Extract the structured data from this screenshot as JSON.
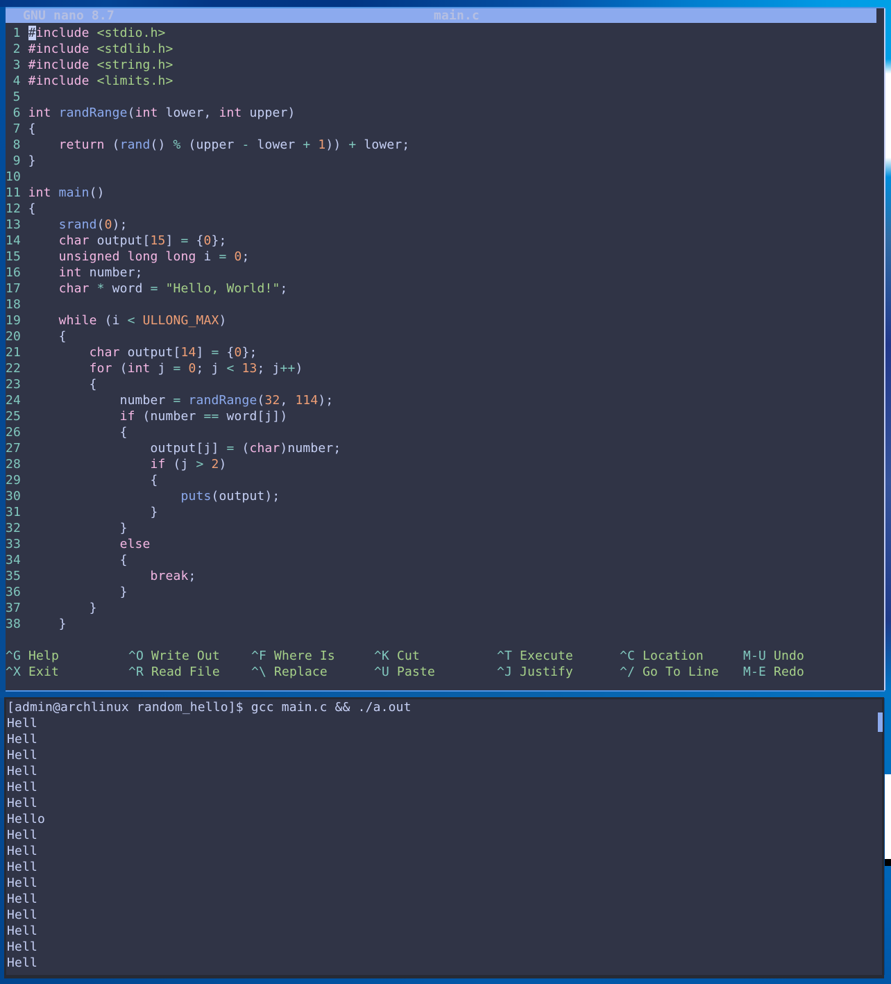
{
  "editor": {
    "app_title": "GNU nano 8.7",
    "filename": "main.c",
    "lines": [
      {
        "num": "1",
        "tok": [
          [
            "cur",
            "#"
          ],
          [
            "k",
            "include"
          ],
          [
            "t",
            " "
          ],
          [
            "s",
            "<stdio.h>"
          ]
        ]
      },
      {
        "num": "2",
        "tok": [
          [
            "k",
            "#include"
          ],
          [
            "t",
            " "
          ],
          [
            "s",
            "<stdlib.h>"
          ]
        ]
      },
      {
        "num": "3",
        "tok": [
          [
            "k",
            "#include"
          ],
          [
            "t",
            " "
          ],
          [
            "s",
            "<string.h>"
          ]
        ]
      },
      {
        "num": "4",
        "tok": [
          [
            "k",
            "#include"
          ],
          [
            "t",
            " "
          ],
          [
            "s",
            "<limits.h>"
          ]
        ]
      },
      {
        "num": "5",
        "tok": []
      },
      {
        "num": "6",
        "tok": [
          [
            "k",
            "int"
          ],
          [
            "t",
            " "
          ],
          [
            "f",
            "randRange"
          ],
          [
            "t",
            "("
          ],
          [
            "k",
            "int"
          ],
          [
            "t",
            " lower, "
          ],
          [
            "k",
            "int"
          ],
          [
            "t",
            " upper)"
          ]
        ]
      },
      {
        "num": "7",
        "tok": [
          [
            "t",
            "{"
          ]
        ]
      },
      {
        "num": "8",
        "tok": [
          [
            "t",
            "    "
          ],
          [
            "k",
            "return"
          ],
          [
            "t",
            " ("
          ],
          [
            "f",
            "rand"
          ],
          [
            "t",
            "() "
          ],
          [
            "o",
            "%"
          ],
          [
            "t",
            " (upper "
          ],
          [
            "o",
            "-"
          ],
          [
            "t",
            " lower "
          ],
          [
            "o",
            "+"
          ],
          [
            "t",
            " "
          ],
          [
            "n",
            "1"
          ],
          [
            "t",
            ")) "
          ],
          [
            "o",
            "+"
          ],
          [
            "t",
            " lower;"
          ]
        ]
      },
      {
        "num": "9",
        "tok": [
          [
            "t",
            "}"
          ]
        ]
      },
      {
        "num": "10",
        "tok": []
      },
      {
        "num": "11",
        "tok": [
          [
            "k",
            "int"
          ],
          [
            "t",
            " "
          ],
          [
            "f",
            "main"
          ],
          [
            "t",
            "()"
          ]
        ]
      },
      {
        "num": "12",
        "tok": [
          [
            "t",
            "{"
          ]
        ]
      },
      {
        "num": "13",
        "tok": [
          [
            "t",
            "    "
          ],
          [
            "f",
            "srand"
          ],
          [
            "t",
            "("
          ],
          [
            "n",
            "0"
          ],
          [
            "t",
            ");"
          ]
        ]
      },
      {
        "num": "14",
        "tok": [
          [
            "t",
            "    "
          ],
          [
            "k",
            "char"
          ],
          [
            "t",
            " output["
          ],
          [
            "n",
            "15"
          ],
          [
            "t",
            "] "
          ],
          [
            "o",
            "="
          ],
          [
            "t",
            " {"
          ],
          [
            "n",
            "0"
          ],
          [
            "t",
            "};"
          ]
        ]
      },
      {
        "num": "15",
        "tok": [
          [
            "t",
            "    "
          ],
          [
            "k",
            "unsigned"
          ],
          [
            "t",
            " "
          ],
          [
            "k",
            "long"
          ],
          [
            "t",
            " "
          ],
          [
            "k",
            "long"
          ],
          [
            "t",
            " i "
          ],
          [
            "o",
            "="
          ],
          [
            "t",
            " "
          ],
          [
            "n",
            "0"
          ],
          [
            "t",
            ";"
          ]
        ]
      },
      {
        "num": "16",
        "tok": [
          [
            "t",
            "    "
          ],
          [
            "k",
            "int"
          ],
          [
            "t",
            " number;"
          ]
        ]
      },
      {
        "num": "17",
        "tok": [
          [
            "t",
            "    "
          ],
          [
            "k",
            "char"
          ],
          [
            "t",
            " "
          ],
          [
            "o",
            "*"
          ],
          [
            "t",
            " word "
          ],
          [
            "o",
            "="
          ],
          [
            "t",
            " "
          ],
          [
            "s",
            "\"Hello, World!\""
          ],
          [
            "t",
            ";"
          ]
        ]
      },
      {
        "num": "18",
        "tok": []
      },
      {
        "num": "19",
        "tok": [
          [
            "t",
            "    "
          ],
          [
            "k",
            "while"
          ],
          [
            "t",
            " (i "
          ],
          [
            "o",
            "<"
          ],
          [
            "t",
            " "
          ],
          [
            "n",
            "ULLONG_MAX"
          ],
          [
            "t",
            ")"
          ]
        ]
      },
      {
        "num": "20",
        "tok": [
          [
            "t",
            "    {"
          ]
        ]
      },
      {
        "num": "21",
        "tok": [
          [
            "t",
            "        "
          ],
          [
            "k",
            "char"
          ],
          [
            "t",
            " output["
          ],
          [
            "n",
            "14"
          ],
          [
            "t",
            "] "
          ],
          [
            "o",
            "="
          ],
          [
            "t",
            " {"
          ],
          [
            "n",
            "0"
          ],
          [
            "t",
            "};"
          ]
        ]
      },
      {
        "num": "22",
        "tok": [
          [
            "t",
            "        "
          ],
          [
            "k",
            "for"
          ],
          [
            "t",
            " ("
          ],
          [
            "k",
            "int"
          ],
          [
            "t",
            " j "
          ],
          [
            "o",
            "="
          ],
          [
            "t",
            " "
          ],
          [
            "n",
            "0"
          ],
          [
            "t",
            "; j "
          ],
          [
            "o",
            "<"
          ],
          [
            "t",
            " "
          ],
          [
            "n",
            "13"
          ],
          [
            "t",
            "; j"
          ],
          [
            "o",
            "++"
          ],
          [
            "t",
            ")"
          ]
        ]
      },
      {
        "num": "23",
        "tok": [
          [
            "t",
            "        {"
          ]
        ]
      },
      {
        "num": "24",
        "tok": [
          [
            "t",
            "            number "
          ],
          [
            "o",
            "="
          ],
          [
            "t",
            " "
          ],
          [
            "f",
            "randRange"
          ],
          [
            "t",
            "("
          ],
          [
            "n",
            "32"
          ],
          [
            "t",
            ", "
          ],
          [
            "n",
            "114"
          ],
          [
            "t",
            ");"
          ]
        ]
      },
      {
        "num": "25",
        "tok": [
          [
            "t",
            "            "
          ],
          [
            "k",
            "if"
          ],
          [
            "t",
            " (number "
          ],
          [
            "o",
            "=="
          ],
          [
            "t",
            " word[j])"
          ]
        ]
      },
      {
        "num": "26",
        "tok": [
          [
            "t",
            "            {"
          ]
        ]
      },
      {
        "num": "27",
        "tok": [
          [
            "t",
            "                output[j] "
          ],
          [
            "o",
            "="
          ],
          [
            "t",
            " ("
          ],
          [
            "k",
            "char"
          ],
          [
            "t",
            ")number;"
          ]
        ]
      },
      {
        "num": "28",
        "tok": [
          [
            "t",
            "                "
          ],
          [
            "k",
            "if"
          ],
          [
            "t",
            " (j "
          ],
          [
            "o",
            ">"
          ],
          [
            "t",
            " "
          ],
          [
            "n",
            "2"
          ],
          [
            "t",
            ")"
          ]
        ]
      },
      {
        "num": "29",
        "tok": [
          [
            "t",
            "                {"
          ]
        ]
      },
      {
        "num": "30",
        "tok": [
          [
            "t",
            "                    "
          ],
          [
            "f",
            "puts"
          ],
          [
            "t",
            "(output);"
          ]
        ]
      },
      {
        "num": "31",
        "tok": [
          [
            "t",
            "                }"
          ]
        ]
      },
      {
        "num": "32",
        "tok": [
          [
            "t",
            "            }"
          ]
        ]
      },
      {
        "num": "33",
        "tok": [
          [
            "t",
            "            "
          ],
          [
            "k",
            "else"
          ]
        ]
      },
      {
        "num": "34",
        "tok": [
          [
            "t",
            "            {"
          ]
        ]
      },
      {
        "num": "35",
        "tok": [
          [
            "t",
            "                "
          ],
          [
            "k",
            "break"
          ],
          [
            "t",
            ";"
          ]
        ]
      },
      {
        "num": "36",
        "tok": [
          [
            "t",
            "            }"
          ]
        ]
      },
      {
        "num": "37",
        "tok": [
          [
            "t",
            "        }"
          ]
        ]
      },
      {
        "num": "38",
        "tok": [
          [
            "t",
            "    }"
          ]
        ]
      }
    ],
    "help_row1": [
      [
        "^G",
        "Help"
      ],
      [
        "^O",
        "Write Out"
      ],
      [
        "^F",
        "Where Is"
      ],
      [
        "^K",
        "Cut"
      ],
      [
        "^T",
        "Execute"
      ],
      [
        "^C",
        "Location"
      ],
      [
        "M-U",
        "Undo"
      ]
    ],
    "help_row2": [
      [
        "^X",
        "Exit"
      ],
      [
        "^R",
        "Read File"
      ],
      [
        "^\\",
        "Replace"
      ],
      [
        "^U",
        "Paste"
      ],
      [
        "^J",
        "Justify"
      ],
      [
        "^/",
        "Go To Line"
      ],
      [
        "M-E",
        "Redo"
      ]
    ]
  },
  "terminal": {
    "lines": [
      "[admin@archlinux random_hello]$ gcc main.c && ./a.out",
      "Hell",
      "Hell",
      "Hell",
      "Hell",
      "Hell",
      "Hell",
      "Hello",
      "Hell",
      "Hell",
      "Hell",
      "Hell",
      "Hell",
      "Hell",
      "Hell",
      "Hell",
      "Hell"
    ]
  },
  "colors": {
    "titlebar": "#8caaee",
    "pane_bg": "#303446",
    "text": "#c6d0f5",
    "keyword": "#f4b8e4",
    "function": "#8caaee",
    "operator": "#81c8be",
    "string": "#a6d189",
    "number": "#ef9f76",
    "line_number": "#81c8be",
    "help_key": "#81c8be",
    "help_label": "#a6d189",
    "scrollbar": "#8caaee"
  }
}
